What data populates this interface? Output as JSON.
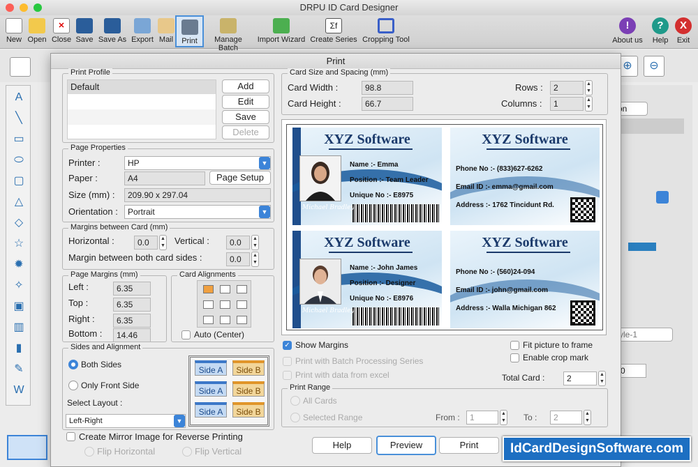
{
  "app": {
    "title": "DRPU ID Card Designer"
  },
  "toolbar": {
    "items": [
      "New",
      "Open",
      "Close",
      "Save",
      "Save As",
      "Export",
      "Mail",
      "Print",
      "Manage Batch",
      "Import Wizard",
      "Create Series",
      "Cropping Tool"
    ],
    "right": [
      "About us",
      "Help",
      "Exit"
    ]
  },
  "dialog": {
    "title": "Print"
  },
  "profile": {
    "legend": "Print Profile",
    "items": [
      "Default"
    ],
    "buttons": [
      "Add",
      "Edit",
      "Save",
      "Delete"
    ]
  },
  "page": {
    "legend": "Page Properties",
    "printer_label": "Printer :",
    "printer": "HP",
    "paper_label": "Paper :",
    "paper": "A4",
    "page_setup": "Page Setup",
    "size_label": "Size (mm) :",
    "size": "209.90 x 297.04",
    "orient_label": "Orientation :",
    "orient": "Portrait"
  },
  "margins": {
    "legend": "Margins between Card (mm)",
    "h_label": "Horizontal :",
    "h": "0.0",
    "v_label": "Vertical :",
    "v": "0.0",
    "both_label": "Margin between both card sides :",
    "both": "0.0"
  },
  "pagemargins": {
    "legend": "Page Margins (mm)",
    "left_label": "Left :",
    "left": "6.35",
    "top_label": "Top :",
    "top": "6.35",
    "right_label": "Right :",
    "right": "6.35",
    "bottom_label": "Bottom :",
    "bottom": "14.46"
  },
  "align": {
    "legend": "Card Alignments",
    "auto": "Auto (Center)"
  },
  "sides": {
    "legend": "Sides and Alignment",
    "both": "Both Sides",
    "front": "Only Front Side",
    "layout_label": "Select Layout :",
    "layout": "Left-Right",
    "a": "Side A",
    "b": "Side B"
  },
  "mirror": {
    "label": "Create Mirror Image for Reverse Printing",
    "flip_h": "Flip Horizontal",
    "flip_v": "Flip Vertical"
  },
  "cardsize": {
    "legend": "Card Size and Spacing (mm)",
    "width_label": "Card Width :",
    "width": "98.8",
    "height_label": "Card Height :",
    "height": "66.7",
    "rows_label": "Rows :",
    "rows": "2",
    "cols_label": "Columns :",
    "cols": "1"
  },
  "cards": [
    {
      "company": "XYZ Software",
      "name": "Name :-  Emma",
      "position": "Position :-  Team Leader",
      "unique": "Unique No :-  E8975",
      "phone": "Phone No :-  (833)627-6262",
      "email": "Email ID :-  emma@gmail.com",
      "address": "Address :-  1762 Tincidunt Rd."
    },
    {
      "company": "XYZ Software",
      "name": "Name :-  John James",
      "position": "Position :-  Designer",
      "unique": "Unique No :-  E8976",
      "phone": "Phone No :-  (560)24-094",
      "email": "Email ID :-  john@gmail.com",
      "address": "Address :-  Walla Michigan 862"
    }
  ],
  "options": {
    "show_margins": "Show Margins",
    "batch": "Print with Batch Processing Series",
    "excel": "Print with data from excel",
    "fit": "Fit picture to frame",
    "crop": "Enable crop mark",
    "total_label": "Total Card :",
    "total": "2"
  },
  "range": {
    "legend": "Print Range",
    "all": "All Cards",
    "selected": "Selected Range",
    "from_label": "From :",
    "from": "1",
    "to_label": "To :",
    "to": "2"
  },
  "footer": {
    "help": "Help",
    "preview": "Preview",
    "print": "Print"
  },
  "right_bg": {
    "tab": "on",
    "style": "yle-1",
    "num": "0"
  },
  "watermark": "IdCardDesignSoftware.com"
}
